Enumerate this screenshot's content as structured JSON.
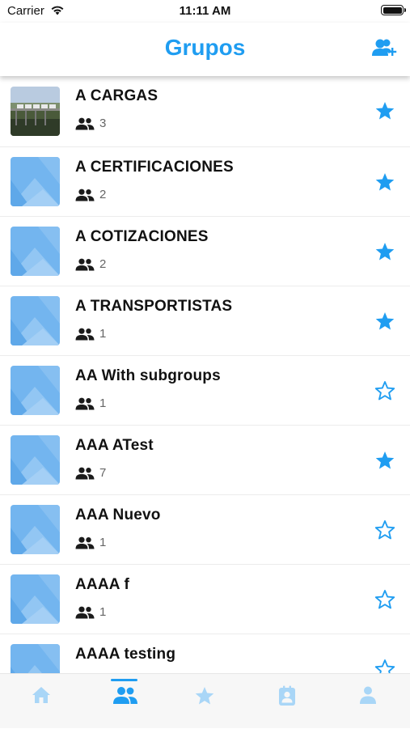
{
  "status_bar": {
    "carrier": "Carrier",
    "time": "11:11 AM"
  },
  "header": {
    "title": "Grupos",
    "action_icon": "add-user-icon"
  },
  "colors": {
    "accent": "#1f9df1",
    "tab_inactive": "#a9d6f7"
  },
  "groups": [
    {
      "name": "A CARGAS",
      "members": "3",
      "favorite": true,
      "thumbnail": "photo"
    },
    {
      "name": "A CERTIFICACIONES",
      "members": "2",
      "favorite": true,
      "thumbnail": "placeholder"
    },
    {
      "name": "A COTIZACIONES",
      "members": "2",
      "favorite": true,
      "thumbnail": "placeholder"
    },
    {
      "name": "A TRANSPORTISTAS",
      "members": "1",
      "favorite": true,
      "thumbnail": "placeholder"
    },
    {
      "name": "AA With subgroups",
      "members": "1",
      "favorite": false,
      "thumbnail": "placeholder"
    },
    {
      "name": "AAA ATest",
      "members": "7",
      "favorite": true,
      "thumbnail": "placeholder"
    },
    {
      "name": "AAA Nuevo",
      "members": "1",
      "favorite": false,
      "thumbnail": "placeholder"
    },
    {
      "name": "AAAA f",
      "members": "1",
      "favorite": false,
      "thumbnail": "placeholder"
    },
    {
      "name": "AAAA testing",
      "members": "",
      "favorite": false,
      "thumbnail": "placeholder"
    }
  ],
  "tabs": [
    {
      "icon": "home-icon",
      "active": false
    },
    {
      "icon": "groups-icon",
      "active": true
    },
    {
      "icon": "star-icon",
      "active": false
    },
    {
      "icon": "contact-card-icon",
      "active": false
    },
    {
      "icon": "profile-icon",
      "active": false
    }
  ]
}
